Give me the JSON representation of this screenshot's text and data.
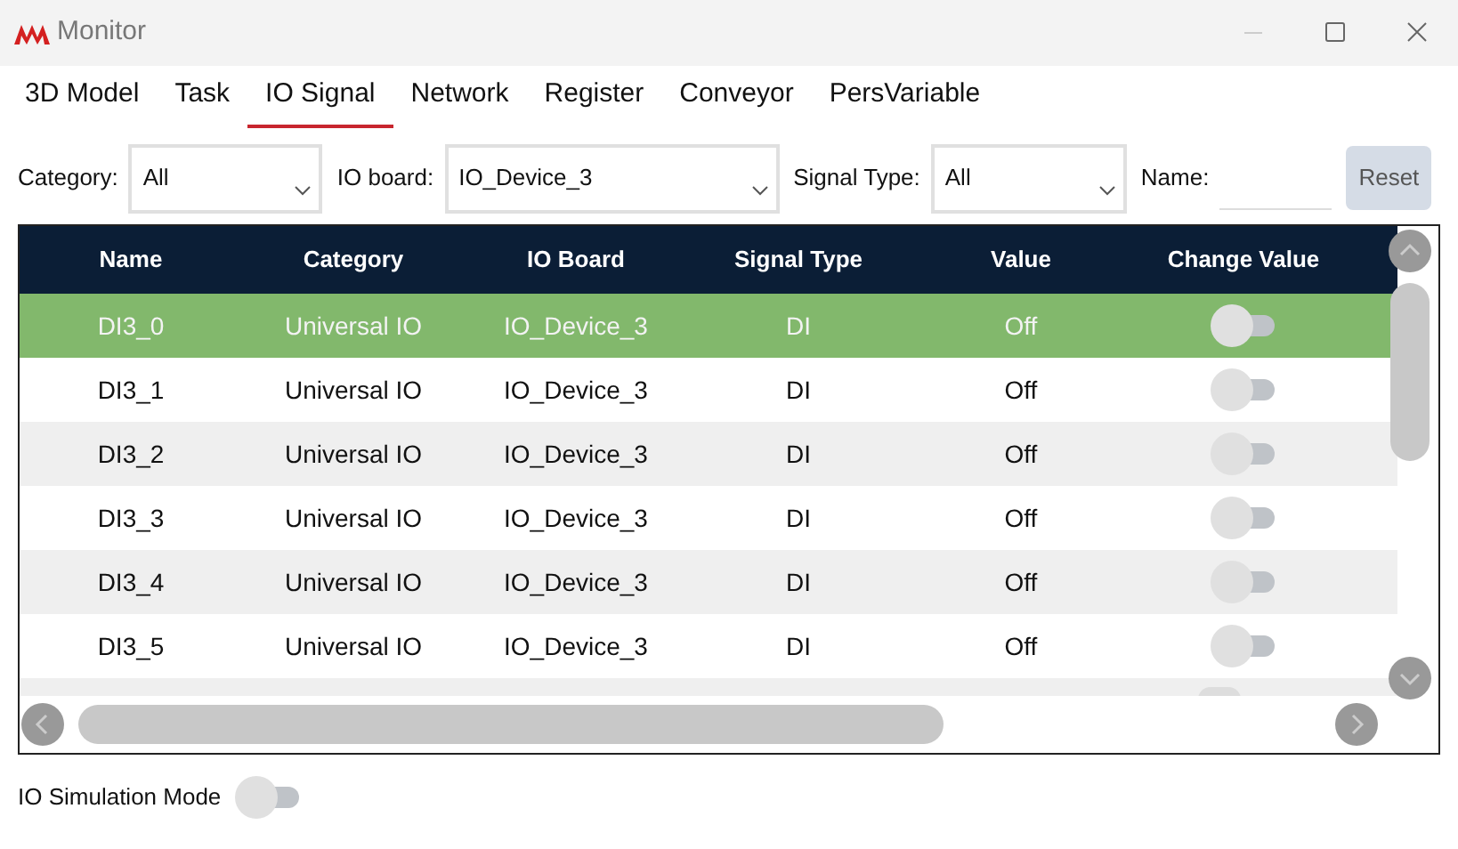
{
  "window": {
    "title": "Monitor"
  },
  "tabs": [
    {
      "label": "3D Model",
      "selected": false
    },
    {
      "label": "Task",
      "selected": false
    },
    {
      "label": "IO Signal",
      "selected": true
    },
    {
      "label": "Network",
      "selected": false
    },
    {
      "label": "Register",
      "selected": false
    },
    {
      "label": "Conveyor",
      "selected": false
    },
    {
      "label": "PersVariable",
      "selected": false
    }
  ],
  "filters": {
    "category": {
      "label": "Category:",
      "value": "All"
    },
    "io_board": {
      "label": "IO board:",
      "value": "IO_Device_3"
    },
    "signal_type": {
      "label": "Signal Type:",
      "value": "All"
    },
    "name": {
      "label": "Name:"
    },
    "reset": "Reset"
  },
  "table": {
    "columns": [
      "Name",
      "Category",
      "IO Board",
      "Signal Type",
      "Value",
      "Change Value"
    ],
    "rows": [
      {
        "cells": [
          "DI3_0",
          "Universal IO",
          "IO_Device_3",
          "DI",
          "Off"
        ],
        "on": false,
        "selected": true
      },
      {
        "cells": [
          "DI3_1",
          "Universal IO",
          "IO_Device_3",
          "DI",
          "Off"
        ],
        "on": false,
        "selected": false
      },
      {
        "cells": [
          "DI3_2",
          "Universal IO",
          "IO_Device_3",
          "DI",
          "Off"
        ],
        "on": false,
        "selected": false
      },
      {
        "cells": [
          "DI3_3",
          "Universal IO",
          "IO_Device_3",
          "DI",
          "Off"
        ],
        "on": false,
        "selected": false
      },
      {
        "cells": [
          "DI3_4",
          "Universal IO",
          "IO_Device_3",
          "DI",
          "Off"
        ],
        "on": false,
        "selected": false
      },
      {
        "cells": [
          "DI3_5",
          "Universal IO",
          "IO_Device_3",
          "DI",
          "Off"
        ],
        "on": false,
        "selected": false
      }
    ]
  },
  "simulation_mode": {
    "label": "IO Simulation Mode",
    "on": false
  }
}
